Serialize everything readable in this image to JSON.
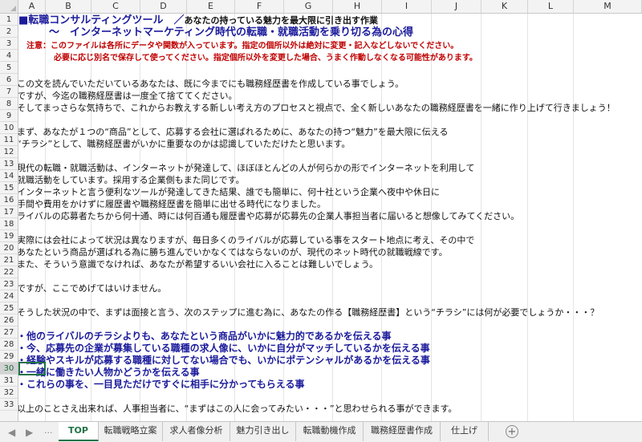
{
  "columns": [
    "A",
    "B",
    "C",
    "D",
    "E",
    "F",
    "G",
    "H",
    "I",
    "J",
    "K",
    "L",
    "M"
  ],
  "rows": [
    "1",
    "2",
    "3",
    "4",
    "5",
    "6",
    "7",
    "8",
    "9",
    "10",
    "11",
    "12",
    "13",
    "14",
    "15",
    "16",
    "17",
    "18",
    "19",
    "20",
    "21",
    "22",
    "23",
    "24",
    "25",
    "26",
    "27",
    "28",
    "29",
    "30",
    "31",
    "32",
    "33"
  ],
  "selected_row": "30",
  "cells": {
    "title1": "■転職コンサルティングツール　／",
    "title1_sub": "あなたの持っている魅力を最大限に引き出す作業",
    "title2": "～　インターネットマーケティング時代の転職・就職活動を乗り切る為の心得",
    "warn1": "注意：このファイルは各所にデータや関数が入っています。指定の個所以外は絶対に変更・記入などしないでください。",
    "warn2": "必要に応じ別名で保存して使ってください。指定個所以外を変更した場合、うまく作動しなくなる可能性があります。",
    "r6": "この文を読んでいただいているあなたは、既に今までにも職務経歴書を作成している事でしょう。",
    "r7": "ですが、今迄の職務経歴書は一度全て捨ててください。",
    "r8": "そしてまっさらな気持ちで、これからお教えする新しい考え方のプロセスと視点で、全く新しいあなたの職務経歴書を一緒に作り上げて行きましょう！",
    "r10": "まず、あなたが１つの“商品”として、応募する会社に選ばれるために、あなたの持つ“魅力”を最大限に伝える",
    "r11": "“チラシ”として、職務経歴書がいかに重要なのかは認識していただけたと思います。",
    "r13": "現代の転職・就職活動は、インターネットが発達して、ほぼほとんどの人が何らかの形でインターネットを利用して",
    "r14": "就職活動をしています。採用する企業側もまた同じです。",
    "r15": "インターネットと言う便利なツールが発達してきた結果、誰でも簡単に、何十社という企業へ夜中や休日に",
    "r16": "手間や費用をかけずに履歴書や職務経歴書を簡単に出せる時代になりました。",
    "r17": "ライバルの応募者たちから何十通、時には何百通も履歴書や応募が応募先の企業人事担当者に届いると想像してみてください。",
    "r19": "実際には会社によって状況は異なりますが、毎日多くのライバルが応募している事をスタート地点に考え、その中で",
    "r20": "あなたという商品が選ばれる為に勝ち進んでいかなくてはならないのが、現代のネット時代の就職戦線です。",
    "r21": "また、そういう意識でなければ、あなたが希望するいい会社に入ることは難しいでしょう。",
    "r23": "ですが、ここでめげてはいけません。",
    "r25": "そうした状況の中で、まずは面接と言う、次のステップに進む為に、あなたの作る【職務経歴書】という“チラシ”には何が必要でしょうか・・・？",
    "r27": "・他のライバルのチラシよりも、あなたという商品がいかに魅力的であるかを伝える事",
    "r28": "・今、応募先の企業が募集している職種の求人像に、いかに自分がマッチしているかを伝える事",
    "r29": "・経験やスキルが応募する職種に対してない場合でも、いかにポテンシャルがあるかを伝える事",
    "r30": "・一緒に働きたい人物かどうかを伝える事",
    "r31": "・これらの事を、一目見ただけですぐに相手に分かってもらえる事",
    "r33": "以上のことさえ出来れば、人事担当者に、“まずはこの人に会ってみたい・・・”と思わせられる事ができます。"
  },
  "sheet_nav": {
    "prev": "◀",
    "next": "▶",
    "dots": "...",
    "add": "+"
  },
  "tabs": [
    "TOP",
    "転職戦略立案",
    "求人者像分析",
    "魅力引き出し",
    "転職動機作成",
    "職務経歴書作成",
    "仕上げ"
  ],
  "active_tab": "TOP"
}
